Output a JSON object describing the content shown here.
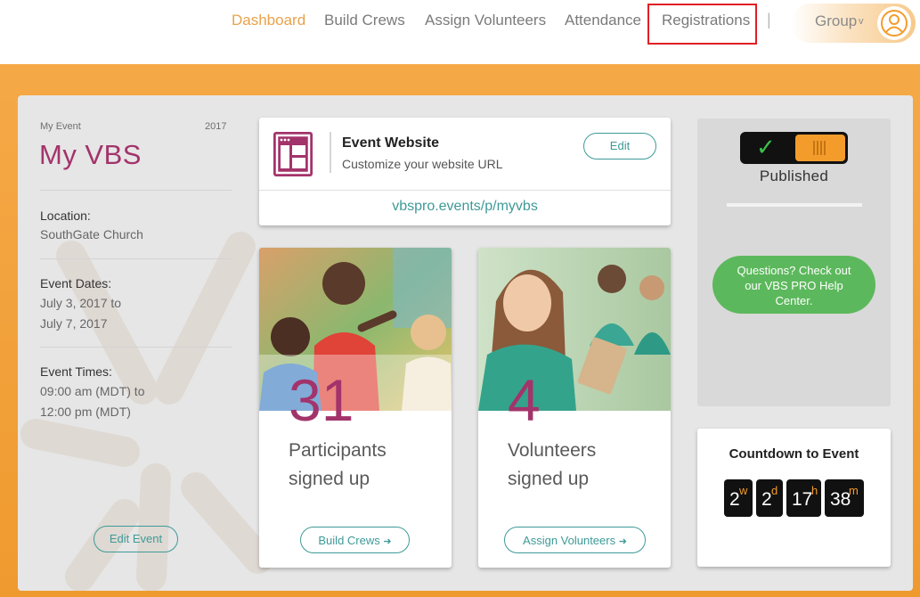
{
  "nav": {
    "dashboard": "Dashboard",
    "build_crews": "Build Crews",
    "assign_volunteers": "Assign Volunteers",
    "attendance": "Attendance",
    "registrations": "Registrations",
    "separator": "|",
    "group": "Group",
    "group_caret": "v"
  },
  "event": {
    "kicker": "My Event",
    "year": "2017",
    "title": "My VBS",
    "location_label": "Location:",
    "location_value": "SouthGate Church",
    "dates_label": "Event Dates:",
    "dates_line1": "July 3, 2017 to",
    "dates_line2": "July 7, 2017",
    "times_label": "Event Times:",
    "times_line1": "09:00 am (MDT) to",
    "times_line2": "12:00 pm (MDT)",
    "edit_button": "Edit Event"
  },
  "website": {
    "title": "Event Website",
    "subtitle": "Customize your website URL",
    "edit_button": "Edit",
    "url": "vbspro.events/p/myvbs"
  },
  "participants": {
    "count": "31",
    "line1": "Participants",
    "line2": "signed up",
    "button": "Build Crews"
  },
  "volunteers": {
    "count": "4",
    "line1": "Volunteers",
    "line2": "signed up",
    "button": "Assign Volunteers"
  },
  "publish": {
    "check": "✓",
    "status": "Published",
    "help": "Questions? Check out our VBS PRO Help Center."
  },
  "countdown": {
    "title": "Countdown to Event",
    "weeks": "2",
    "weeks_unit": "w",
    "days": "2",
    "days_unit": "d",
    "hours": "17",
    "hours_unit": "h",
    "minutes": "38",
    "minutes_unit": "m"
  },
  "colors": {
    "brand_orange": "#f5a947",
    "accent_purple": "#a3336b",
    "teal": "#3e9a97",
    "help_green": "#5cb85c",
    "highlight_red": "#e01f26"
  }
}
